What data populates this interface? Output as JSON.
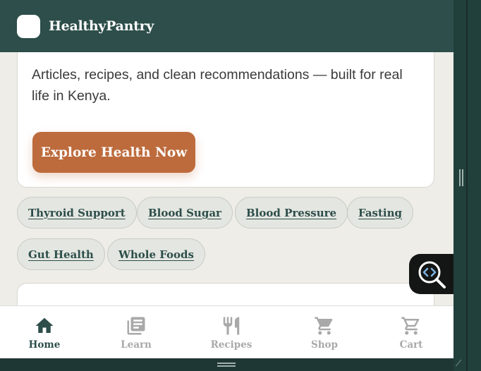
{
  "header": {
    "brand": "HealthyPantry"
  },
  "hero": {
    "text": "Articles, recipes, and clean recommendations — built for real life in Kenya.",
    "cta_label": "Explore Health Now"
  },
  "chips": [
    {
      "label": "Thyroid Support"
    },
    {
      "label": "Blood Sugar"
    },
    {
      "label": "Blood Pressure"
    },
    {
      "label": "Fasting"
    },
    {
      "label": "Gut Health"
    },
    {
      "label": "Whole Foods"
    }
  ],
  "bottom_nav": {
    "items": [
      {
        "label": "Home",
        "icon": "home-icon",
        "active": true
      },
      {
        "label": "Learn",
        "icon": "library-icon",
        "active": false
      },
      {
        "label": "Recipes",
        "icon": "fork-knife-icon",
        "active": false
      },
      {
        "label": "Shop",
        "icon": "shopping-cart-icon",
        "active": false
      },
      {
        "label": "Cart",
        "icon": "cart-outline-icon",
        "active": false
      }
    ]
  },
  "fab": {
    "icon": "code-search-icon"
  },
  "colors": {
    "header_bg": "#2d4e4a",
    "accent": "#bd6b3c",
    "page_bg": "#efede8",
    "active_nav": "#2d4e4a",
    "inactive_nav": "#a9a9a9"
  }
}
